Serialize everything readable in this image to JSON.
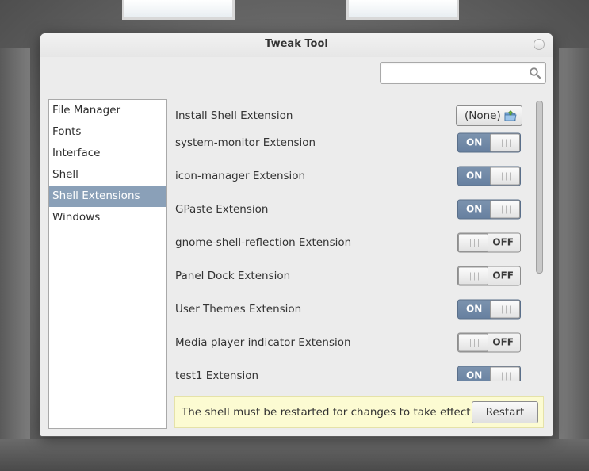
{
  "window": {
    "title": "Tweak Tool",
    "close_icon": "close-icon"
  },
  "search": {
    "value": "",
    "placeholder": "",
    "icon": "search-icon"
  },
  "sidebar": {
    "items": [
      {
        "label": "File Manager",
        "selected": false
      },
      {
        "label": "Fonts",
        "selected": false
      },
      {
        "label": "Interface",
        "selected": false
      },
      {
        "label": "Shell",
        "selected": false
      },
      {
        "label": "Shell Extensions",
        "selected": true
      },
      {
        "label": "Windows",
        "selected": false
      }
    ]
  },
  "install": {
    "label": "Install Shell Extension",
    "button_label": "(None)",
    "icon": "folder-open-icon"
  },
  "extensions": [
    {
      "label": "system-monitor Extension",
      "state": "ON"
    },
    {
      "label": "icon-manager Extension",
      "state": "ON"
    },
    {
      "label": "GPaste Extension",
      "state": "ON"
    },
    {
      "label": "gnome-shell-reflection Extension",
      "state": "OFF"
    },
    {
      "label": "Panel Dock Extension",
      "state": "OFF"
    },
    {
      "label": "User Themes Extension",
      "state": "ON"
    },
    {
      "label": "Media player indicator Extension",
      "state": "OFF"
    },
    {
      "label": "test1 Extension",
      "state": "ON"
    }
  ],
  "infobar": {
    "message": "The shell must be restarted for changes to take effect",
    "button_label": "Restart"
  },
  "colors": {
    "selection": "#8aa0b8",
    "switch_on": "#7088a6",
    "infobar_bg": "#fcfbd2"
  }
}
